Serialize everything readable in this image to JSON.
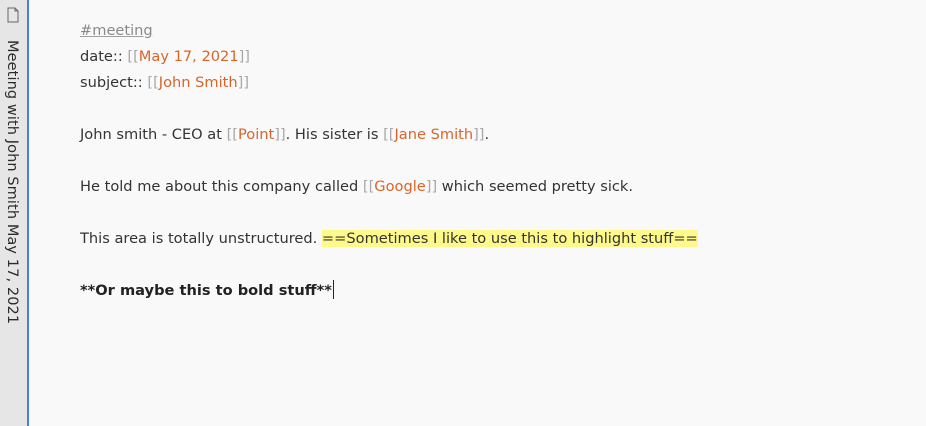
{
  "sidebar": {
    "title": "Meeting with John Smith May 17, 2021",
    "icon": "file-icon"
  },
  "note": {
    "tag": "#meeting",
    "date_key": "date:: ",
    "date_value": "May 17, 2021",
    "subject_key": "subject:: ",
    "subject_value": "John Smith",
    "para1_a": "John smith - CEO at ",
    "para1_link1": "Point",
    "para1_b": ". His sister is ",
    "para1_link2": "Jane Smith",
    "para1_c": ".",
    "para2_a": "He told me about this company called ",
    "para2_link": "Google",
    "para2_b": " which seemed pretty sick.",
    "para3_a": "This area is totally unstructured. ",
    "para3_highlight": "==Sometimes I like to use this to highlight stuff==",
    "para4_bold": "**Or maybe this to bold stuff**",
    "bracket_open": "[[",
    "bracket_close": "]]"
  },
  "colors": {
    "link": "#d9642a",
    "highlight": "#fdf98a",
    "tab_border": "#4a7fe0"
  }
}
